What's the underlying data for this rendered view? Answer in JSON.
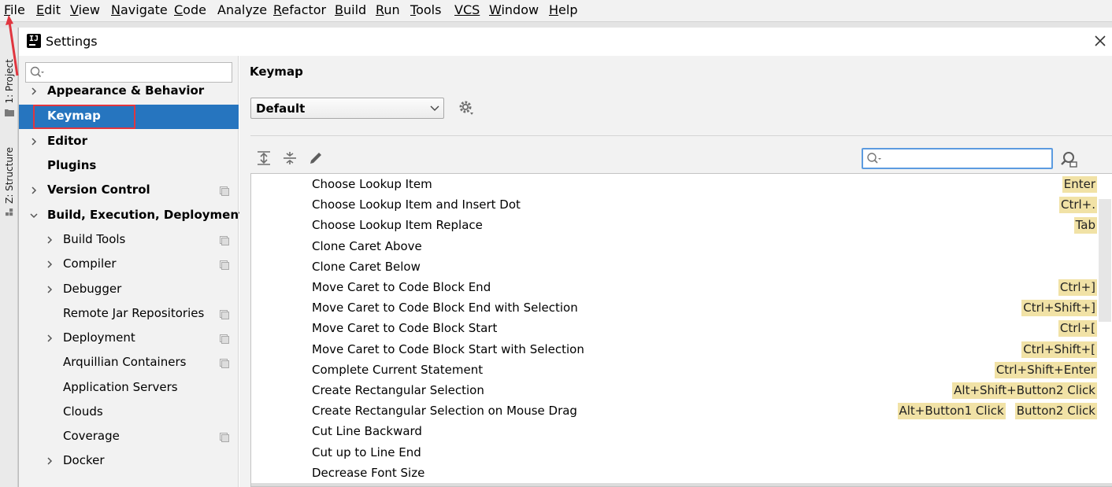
{
  "menubar": {
    "items": [
      {
        "mnemonic": "F",
        "rest": "ile"
      },
      {
        "mnemonic": "E",
        "rest": "dit"
      },
      {
        "mnemonic": "V",
        "rest": "iew"
      },
      {
        "mnemonic": "N",
        "rest": "avigate"
      },
      {
        "mnemonic": "C",
        "rest": "ode"
      },
      {
        "mnemonic": "",
        "rest": "Analyze"
      },
      {
        "mnemonic": "R",
        "rest": "efactor"
      },
      {
        "mnemonic": "B",
        "rest": "uild"
      },
      {
        "mnemonic": "R",
        "rest": "un"
      },
      {
        "mnemonic": "T",
        "rest": "ools"
      },
      {
        "mnemonic": "VCS",
        "rest": ""
      },
      {
        "mnemonic": "W",
        "rest": "indow"
      },
      {
        "mnemonic": "H",
        "rest": "elp"
      }
    ]
  },
  "toolstrip": {
    "project_tab": "1: Project",
    "structure_tab": "Z: Structure"
  },
  "dialog": {
    "title": "Settings",
    "logo_text": "IJ"
  },
  "sidebar": {
    "search_placeholder": "",
    "items": [
      {
        "label": "Appearance & Behavior",
        "bold": true,
        "expandable": true,
        "expanded": false,
        "indent": 0,
        "project_level": false
      },
      {
        "label": "Keymap",
        "bold": true,
        "expandable": false,
        "expanded": false,
        "indent": 0,
        "project_level": false,
        "selected": true
      },
      {
        "label": "Editor",
        "bold": true,
        "expandable": true,
        "expanded": false,
        "indent": 0,
        "project_level": false
      },
      {
        "label": "Plugins",
        "bold": true,
        "expandable": false,
        "expanded": false,
        "indent": 0,
        "project_level": false
      },
      {
        "label": "Version Control",
        "bold": true,
        "expandable": true,
        "expanded": false,
        "indent": 0,
        "project_level": true
      },
      {
        "label": "Build, Execution, Deployment",
        "bold": true,
        "expandable": true,
        "expanded": true,
        "indent": 0,
        "project_level": false
      },
      {
        "label": "Build Tools",
        "bold": false,
        "expandable": true,
        "expanded": false,
        "indent": 1,
        "project_level": true
      },
      {
        "label": "Compiler",
        "bold": false,
        "expandable": true,
        "expanded": false,
        "indent": 1,
        "project_level": true
      },
      {
        "label": "Debugger",
        "bold": false,
        "expandable": true,
        "expanded": false,
        "indent": 1,
        "project_level": false
      },
      {
        "label": "Remote Jar Repositories",
        "bold": false,
        "expandable": false,
        "expanded": false,
        "indent": 1,
        "project_level": true
      },
      {
        "label": "Deployment",
        "bold": false,
        "expandable": true,
        "expanded": false,
        "indent": 1,
        "project_level": true
      },
      {
        "label": "Arquillian Containers",
        "bold": false,
        "expandable": false,
        "expanded": false,
        "indent": 1,
        "project_level": true
      },
      {
        "label": "Application Servers",
        "bold": false,
        "expandable": false,
        "expanded": false,
        "indent": 1,
        "project_level": false
      },
      {
        "label": "Clouds",
        "bold": false,
        "expandable": false,
        "expanded": false,
        "indent": 1,
        "project_level": false
      },
      {
        "label": "Coverage",
        "bold": false,
        "expandable": false,
        "expanded": false,
        "indent": 1,
        "project_level": true
      },
      {
        "label": "Docker",
        "bold": false,
        "expandable": true,
        "expanded": false,
        "indent": 1,
        "project_level": false
      }
    ]
  },
  "main": {
    "title": "Keymap",
    "scheme": "Default",
    "search_value": "",
    "toolbar_icons": [
      "expand-all-icon",
      "collapse-all-icon",
      "edit-shortcut-icon"
    ],
    "actions": [
      {
        "name": "Choose Lookup Item",
        "shortcuts": [
          "Enter"
        ]
      },
      {
        "name": "Choose Lookup Item and Insert Dot",
        "shortcuts": [
          "Ctrl+."
        ]
      },
      {
        "name": "Choose Lookup Item Replace",
        "shortcuts": [
          "Tab"
        ]
      },
      {
        "name": "Clone Caret Above",
        "shortcuts": []
      },
      {
        "name": "Clone Caret Below",
        "shortcuts": []
      },
      {
        "name": "Move Caret to Code Block End",
        "shortcuts": [
          "Ctrl+]"
        ]
      },
      {
        "name": "Move Caret to Code Block End with Selection",
        "shortcuts": [
          "Ctrl+Shift+]"
        ]
      },
      {
        "name": "Move Caret to Code Block Start",
        "shortcuts": [
          "Ctrl+["
        ]
      },
      {
        "name": "Move Caret to Code Block Start with Selection",
        "shortcuts": [
          "Ctrl+Shift+["
        ]
      },
      {
        "name": "Complete Current Statement",
        "shortcuts": [
          "Ctrl+Shift+Enter"
        ]
      },
      {
        "name": "Create Rectangular Selection",
        "shortcuts": [
          "Alt+Shift+Button2 Click"
        ]
      },
      {
        "name": "Create Rectangular Selection on Mouse Drag",
        "shortcuts": [
          "Alt+Button1 Click",
          "Button2 Click"
        ]
      },
      {
        "name": "Cut Line Backward",
        "shortcuts": []
      },
      {
        "name": "Cut up to Line End",
        "shortcuts": []
      },
      {
        "name": "Decrease Font Size",
        "shortcuts": []
      }
    ]
  },
  "colors": {
    "selection": "#2675bf",
    "shortcut_bg": "#f1e2a6",
    "annotation_red": "#e0363f",
    "search_focus": "#5c9be0"
  }
}
